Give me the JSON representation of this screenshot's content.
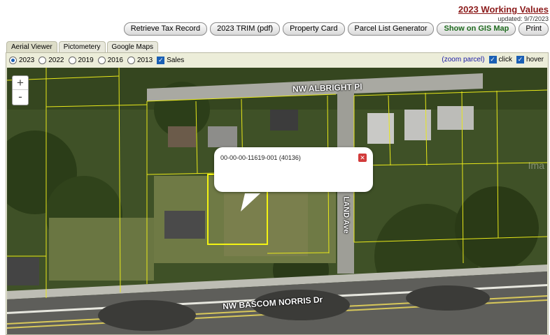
{
  "header": {
    "working_values": "2023 Working Values",
    "updated": "updated: 9/7/2023"
  },
  "toolbar": {
    "buttons": [
      "Retrieve Tax Record",
      "2023 TRIM (pdf)",
      "Property Card",
      "Parcel List Generator",
      "Show on GIS Map",
      "Print"
    ]
  },
  "tabs": [
    "Aerial Viewer",
    "Pictometery",
    "Google Maps"
  ],
  "options": {
    "years": [
      "2023",
      "2022",
      "2019",
      "2016",
      "2013"
    ],
    "selected_year": "2023",
    "sales_label": "Sales",
    "zoom_link": "(zoom parcel)",
    "click_label": "click",
    "hover_label": "hover"
  },
  "map": {
    "zoom_in": "+",
    "zoom_out": "-",
    "popup_text": "00-00-00-11619-001 (40136)",
    "road_albright": "NW ALBRIGHT Pl",
    "road_bascom": "NW BASCOM NORRIS Dr",
    "road_land": "LAND Ave",
    "watermark": "Ima"
  },
  "colors": {
    "accent": "#8b1a1a",
    "gis_button": "#1f6b1f",
    "parcel_line": "#e8e81a",
    "selected_parcel": "#f3f312"
  }
}
